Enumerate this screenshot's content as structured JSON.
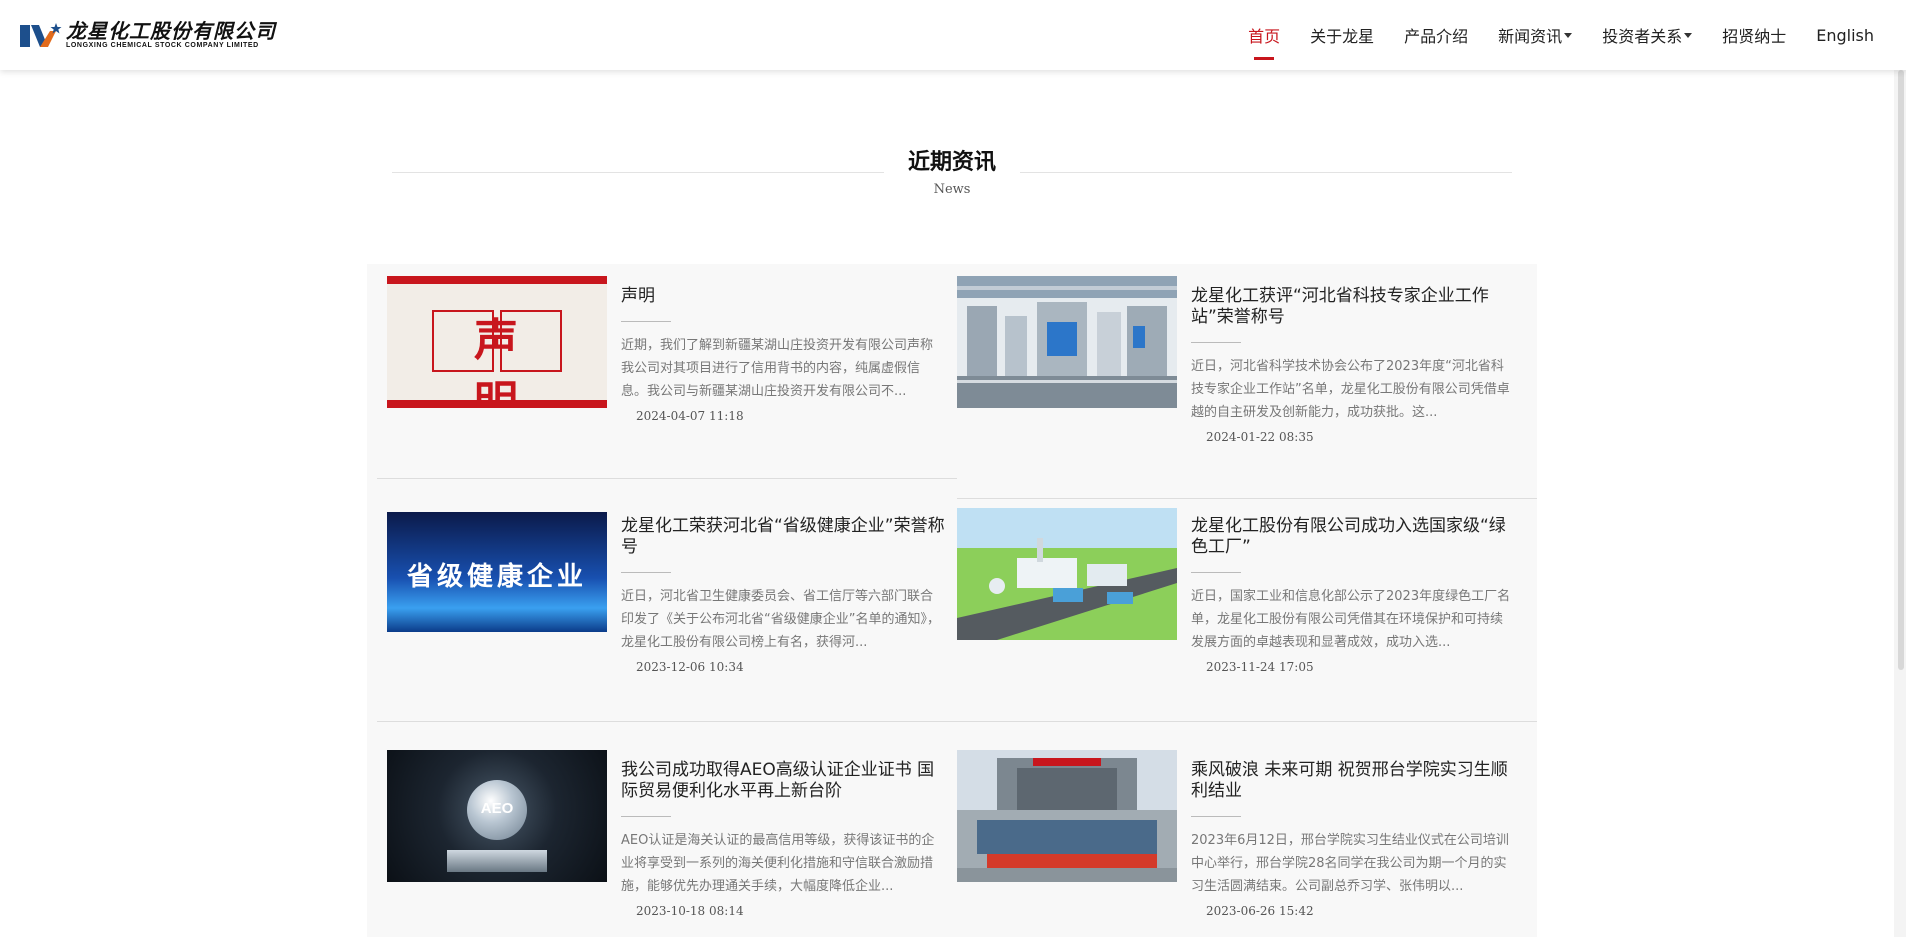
{
  "header": {
    "logo_cn": "龙星化工股份有限公司",
    "logo_en": "LONGXING CHEMICAL STOCK COMPANY LIMITED",
    "nav": [
      {
        "label": "首页",
        "active": true
      },
      {
        "label": "关于龙星"
      },
      {
        "label": "产品介绍"
      },
      {
        "label": "新闻资讯",
        "dropdown": true
      },
      {
        "label": "投资者关系",
        "dropdown": true
      },
      {
        "label": "招贤纳士"
      },
      {
        "label": "English"
      }
    ]
  },
  "section": {
    "title": "近期资讯",
    "subtitle": "News"
  },
  "news": [
    {
      "title": "声明",
      "desc": "近期，我们了解到新疆某湖山庄投资开发有限公司声称我公司对其项目进行了信用背书的内容，纯属虚假信息。我公司与新疆某湖山庄投资开发有限公司不...",
      "date": "2024-04-07 11:18",
      "image_text": "声明"
    },
    {
      "title": "龙星化工获评“河北省科技专家企业工作站”荣誉称号",
      "desc": "近日，河北省科学技术协会公布了2023年度“河北省科技专家企业工作站”名单，龙星化工股份有限公司凭借卓越的自主研发及创新能力，成功获批。这...",
      "date": "2024-01-22 08:35"
    },
    {
      "title": "龙星化工荣获河北省“省级健康企业”荣誉称号",
      "desc": "近日，河北省卫生健康委员会、省工信厅等六部门联合印发了《关于公布河北省“省级健康企业”名单的通知》，龙星化工股份有限公司榜上有名，获得河...",
      "date": "2023-12-06 10:34",
      "image_text": "省级健康企业"
    },
    {
      "title": "龙星化工股份有限公司成功入选国家级“绿色工厂”",
      "desc": "近日，国家工业和信息化部公示了2023年度绿色工厂名单，龙星化工股份有限公司凭借其在环境保护和可持续发展方面的卓越表现和显著成效，成功入选...",
      "date": "2023-11-24 17:05"
    },
    {
      "title": "我公司成功取得AEO高级认证企业证书 国际贸易便利化水平再上新台阶",
      "desc": "AEO认证是海关认证的最高信用等级，获得该证书的企业将享受到一系列的海关便利化措施和守信联合激励措施，能够优先办理通关手续，大幅度降低企业...",
      "date": "2023-10-18 08:14",
      "image_text": "AEO"
    },
    {
      "title": "乘风破浪 未来可期 祝贺邢台学院实习生顺利结业",
      "desc": "2023年6月12日，邢台学院实习生结业仪式在公司培训中心举行，邢台学院28名同学在我公司为期一个月的实习生活圆满结束。公司副总乔习学、张伟明以...",
      "date": "2023-06-26 15:42"
    }
  ],
  "colors": {
    "accent": "#c8161d",
    "brand_blue": "#1d4f8c"
  }
}
